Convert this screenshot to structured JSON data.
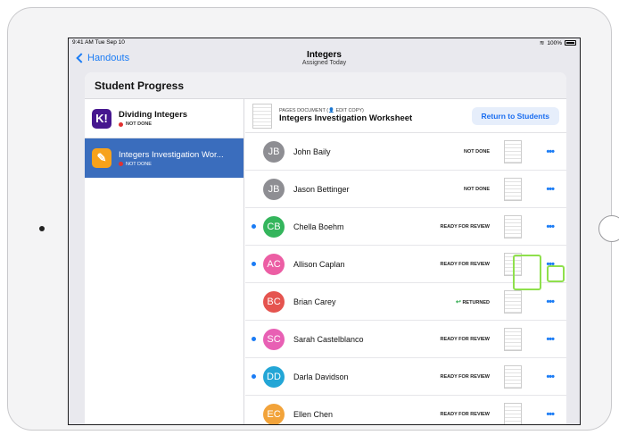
{
  "status_bar": {
    "time": "9:41 AM  Tue Sep 10",
    "battery": "100%"
  },
  "nav": {
    "back_label": "Handouts",
    "title": "Integers",
    "subtitle": "Assigned Today"
  },
  "panel_title": "Student Progress",
  "sidebar": [
    {
      "title": "Dividing Integers",
      "status": "NOT DONE",
      "icon": "kahoot-icon",
      "icon_glyph": "K!"
    },
    {
      "title": "Integers Investigation Wor...",
      "status": "NOT DONE",
      "icon": "pages-icon",
      "icon_glyph": "✎"
    }
  ],
  "document": {
    "kind": "PAGES DOCUMENT (👤 EDIT COPY)",
    "title": "Integers Investigation Worksheet",
    "return_button": "Return to Students"
  },
  "students": [
    {
      "initials": "JB",
      "name": "John Baily",
      "status": "NOT DONE",
      "color": "#8e8e93",
      "unread": false
    },
    {
      "initials": "JB",
      "name": "Jason Bettinger",
      "status": "NOT DONE",
      "color": "#8e8e93",
      "unread": false
    },
    {
      "initials": "CB",
      "name": "Chella Boehm",
      "status": "READY FOR REVIEW",
      "color": "#34b55c",
      "unread": true
    },
    {
      "initials": "AC",
      "name": "Allison Caplan",
      "status": "READY FOR REVIEW",
      "color": "#ec5ea4",
      "unread": true
    },
    {
      "initials": "BC",
      "name": "Brian Carey",
      "status": "RETURNED",
      "color": "#e5544f",
      "unread": false
    },
    {
      "initials": "SC",
      "name": "Sarah Castelblanco",
      "status": "READY FOR REVIEW",
      "color": "#e860b4",
      "unread": true
    },
    {
      "initials": "DD",
      "name": "Darla Davidson",
      "status": "READY FOR REVIEW",
      "color": "#23a6d6",
      "unread": true
    },
    {
      "initials": "EC",
      "name": "Ellen Chen",
      "status": "READY FOR REVIEW",
      "color": "#f2a33a",
      "unread": false
    }
  ],
  "more_glyph": "•••",
  "returned_glyph": "↩"
}
